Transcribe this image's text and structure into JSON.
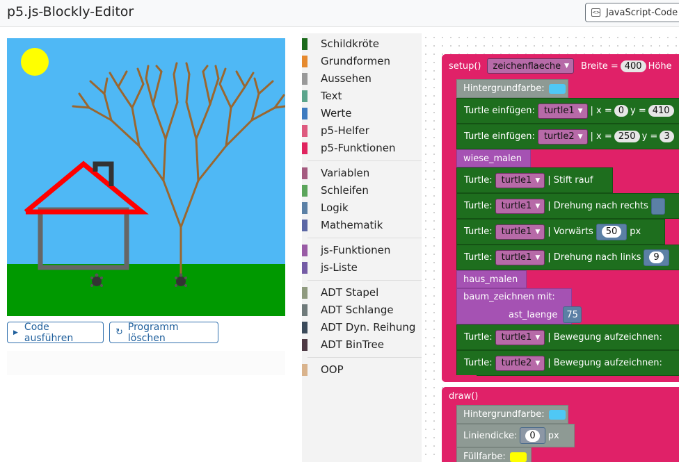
{
  "header": {
    "title": "p5.js-Blockly-Editor",
    "js_button": "JavaScript-Code"
  },
  "buttons": {
    "run": "Code ausführen",
    "clear": "Programm löschen"
  },
  "toolbox": {
    "categories": [
      {
        "label": "Schildkröte",
        "color": "#1b6a1b"
      },
      {
        "label": "Grundformen",
        "color": "#e68a2e"
      },
      {
        "label": "Aussehen",
        "color": "#999999"
      },
      {
        "label": "Text",
        "color": "#5ba58c"
      },
      {
        "label": "Werte",
        "color": "#3d7bc0"
      },
      {
        "label": "p5-Helfer",
        "color": "#de5a7f"
      },
      {
        "label": "p5-Funktionen",
        "color": "#e0245f"
      },
      {
        "label": "Variablen",
        "color": "#a55b80"
      },
      {
        "label": "Schleifen",
        "color": "#5ba55b"
      },
      {
        "label": "Logik",
        "color": "#5b80a5"
      },
      {
        "label": "Mathematik",
        "color": "#5b67a5"
      },
      {
        "label": "js-Funktionen",
        "color": "#995ba5"
      },
      {
        "label": "js-Liste",
        "color": "#745ba5"
      },
      {
        "label": "ADT Stapel",
        "color": "#8f9a7f"
      },
      {
        "label": "ADT Schlange",
        "color": "#6f7a7a"
      },
      {
        "label": "ADT Dyn. Reihung",
        "color": "#3b4a5a"
      },
      {
        "label": "ADT BinTree",
        "color": "#4e3a44"
      },
      {
        "label": "OOP",
        "color": "#d9b38c"
      }
    ]
  },
  "blocks": {
    "setup_label": "setup()",
    "canvas_var": "zeichenflaeche",
    "breite_label": "Breite =",
    "breite_value": "400",
    "hoehe_label": "Höhe",
    "bg_label": "Hintergrundfarbe:",
    "turtle_insert": "Turtle einfügen:",
    "turtle1": "turtle1",
    "turtle2": "turtle2",
    "x_label": "| x =",
    "y_label": "y =",
    "t1x": "0",
    "t1y": "410",
    "t2x": "250",
    "t2y": "3",
    "wiese": "wiese_malen",
    "turtle_label": "Turtle:",
    "stift_rauf": "| Stift rauf",
    "drehung_rechts": "| Drehung nach rechts",
    "vorwaerts": "| Vorwärts",
    "vorwaerts_value": "50",
    "px": "px",
    "drehung_links": "| Drehung nach links",
    "links_value": "9",
    "haus": "haus_malen",
    "baum": "baum_zeichnen  mit:",
    "ast": "ast_laenge",
    "ast_value": "75",
    "bewegung": "| Bewegung aufzeichnen:",
    "draw_label": "draw()",
    "liniendicke": "Liniendicke:",
    "linie_value": "0",
    "fuell": "Füllfarbe:"
  },
  "colors": {
    "sky": "#4fb8f5",
    "grass": "#009900",
    "sun": "#ffff00",
    "roof": "#ff0000",
    "walls": "#666666",
    "chimney": "#333333",
    "tree": "#9a6730"
  }
}
